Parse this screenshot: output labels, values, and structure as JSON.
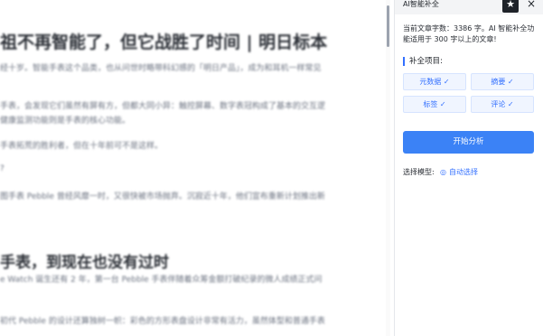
{
  "article": {
    "title": "祖不再智能了，但它战胜了时间 | 明日标本",
    "paragraphs": [
      "经十岁。智能手表这个品类，也从问世时略带科幻感的「明日产品」，成为和耳机一样常见",
      "手表，会发现它们虽然有屏有方，但都大同小异：触控屏幕、数字表冠构成了基本的交互逻",
      "健康监测功能则是手表的核心功能。",
      "手表拓荒的胜利者，但在十年前可不是这样。",
      "?",
      "图手表 Pebble 曾经风靡一时，又很快被市场抛弃。沉寂近十年，他们宣布重新计划推出新"
    ],
    "subtitle": "手表，到现在也没有过时",
    "paragraphs2": [
      "e Watch 诞生还有 2 年，第一台 Pebble 手表伴随着众筹金额打破纪录的微人成绩正式问",
      "初代 Pebble 的设计还算独树一帜：彩色的方形表盘设计非常有活力，虽然体型和普通手表"
    ]
  },
  "panel": {
    "title": "AI智能补全",
    "pin_icon": "★",
    "close_icon": "×",
    "info": "当前文章字数：3386 字。AI 智能补全功能适用于 300 字以上的文章!",
    "section_title": "补全项目:",
    "tags": [
      "元数据 ✓",
      "摘要 ✓",
      "标签 ✓",
      "评论 ✓"
    ],
    "start_button": "开始分析",
    "model_label": "选择模型:",
    "model_icon": "◎",
    "model_value": "自动选择"
  },
  "colors": {
    "accent": "#3370ff",
    "button": "#3b82f6",
    "tag_bg": "#f0f5ff"
  }
}
